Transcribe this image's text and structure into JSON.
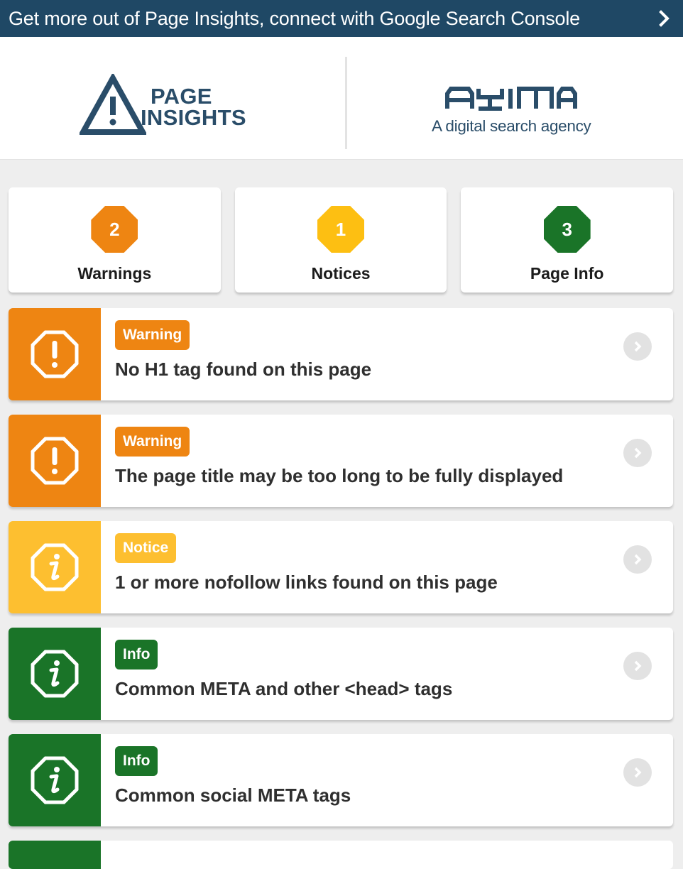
{
  "banner": {
    "text": "Get more out of Page Insights, connect with Google Search Console",
    "icon": "chevron-right-icon"
  },
  "header": {
    "logo_page_insights": {
      "line1": "PAGE",
      "line2": "INSIGHTS"
    },
    "logo_ayima": {
      "wordmark": "AYIMA",
      "tagline": "A digital search agency"
    }
  },
  "summary": [
    {
      "count": "2",
      "label": "Warnings",
      "color": "#ee8512"
    },
    {
      "count": "1",
      "label": "Notices",
      "color": "#fdbf12"
    },
    {
      "count": "3",
      "label": "Page Info",
      "color": "#1a7428"
    }
  ],
  "issues": [
    {
      "badge": "Warning",
      "title": "No H1 tag found on this page",
      "color": "#ee8512",
      "icon": "exclamation-octagon-icon"
    },
    {
      "badge": "Warning",
      "title": "The page title may be too long to be fully displayed",
      "color": "#ee8512",
      "icon": "exclamation-octagon-icon"
    },
    {
      "badge": "Notice",
      "title": "1 or more nofollow links found on this page",
      "color": "#fdbf30",
      "icon": "info-octagon-icon"
    },
    {
      "badge": "Info",
      "title": "Common META and other <head> tags",
      "color": "#1a7428",
      "icon": "info-octagon-icon"
    },
    {
      "badge": "Info",
      "title": "Common social META tags",
      "color": "#1a7428",
      "icon": "info-octagon-icon"
    }
  ],
  "colors": {
    "banner": "#1f4865",
    "brand_text": "#2a4d69",
    "warning": "#ee8512",
    "notice": "#fdbf30",
    "info": "#1a7428",
    "background": "#eeeeee"
  }
}
